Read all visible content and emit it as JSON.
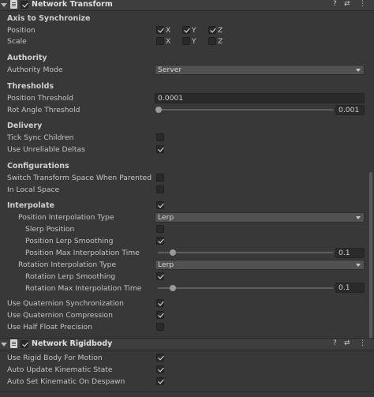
{
  "network_transform": {
    "title": "Network Transform",
    "sections": {
      "axis": "Axis to Synchronize",
      "authority": "Authority",
      "thresholds": "Thresholds",
      "delivery": "Delivery",
      "configurations": "Configurations"
    },
    "position_label": "Position",
    "scale_label": "Scale",
    "axes": [
      "X",
      "Y",
      "Z"
    ],
    "authority_mode_label": "Authority Mode",
    "authority_mode_value": "Server",
    "position_threshold_label": "Position Threshold",
    "position_threshold_value": "0.0001",
    "rot_angle_threshold_label": "Rot Angle Threshold",
    "rot_angle_threshold_value": "0.001",
    "tick_sync_children_label": "Tick Sync Children",
    "use_unreliable_deltas_label": "Use Unreliable Deltas",
    "switch_transform_space_label": "Switch Transform Space When Parented",
    "in_local_space_label": "In Local Space",
    "interpolate_label": "Interpolate",
    "position_interp_type_label": "Position Interpolation Type",
    "position_interp_type_value": "Lerp",
    "slerp_position_label": "Slerp Position",
    "position_lerp_smoothing_label": "Position Lerp Smoothing",
    "position_max_interp_time_label": "Position Max Interpolation Time",
    "position_max_interp_time_value": "0.1",
    "rotation_interp_type_label": "Rotation Interpolation Type",
    "rotation_interp_type_value": "Lerp",
    "rotation_lerp_smoothing_label": "Rotation Lerp Smoothing",
    "rotation_max_interp_time_label": "Rotation Max Interpolation Time",
    "rotation_max_interp_time_value": "0.1",
    "use_quaternion_sync_label": "Use Quaternion Synchronization",
    "use_quaternion_compression_label": "Use Quaternion Compression",
    "use_half_float_label": "Use Half Float Precision"
  },
  "network_rigidbody": {
    "title": "Network Rigidbody",
    "use_rigid_body_label": "Use Rigid Body For Motion",
    "auto_update_kinematic_label": "Auto Update Kinematic State",
    "auto_set_kinematic_label": "Auto Set Kinematic On Despawn"
  },
  "header_icons": {
    "help": "?",
    "presets": "⇄",
    "menu": "⋮"
  },
  "checkbox_states": {
    "position_x": true,
    "position_y": true,
    "position_z": true,
    "scale_x": false,
    "scale_y": false,
    "scale_z": false,
    "tick_sync_children": false,
    "use_unreliable_deltas": true,
    "switch_transform_space": false,
    "in_local_space": false,
    "interpolate": true,
    "slerp_position": false,
    "position_lerp_smoothing": true,
    "rotation_lerp_smoothing": true,
    "use_quaternion_sync": true,
    "use_quaternion_compression": true,
    "use_half_float": false,
    "use_rigid_body": true,
    "auto_update_kinematic": true,
    "auto_set_kinematic": true
  },
  "colors": {
    "background": "#383838",
    "header": "#3e3e3e",
    "field": "#2a2a2a",
    "dropdown": "#515151"
  }
}
